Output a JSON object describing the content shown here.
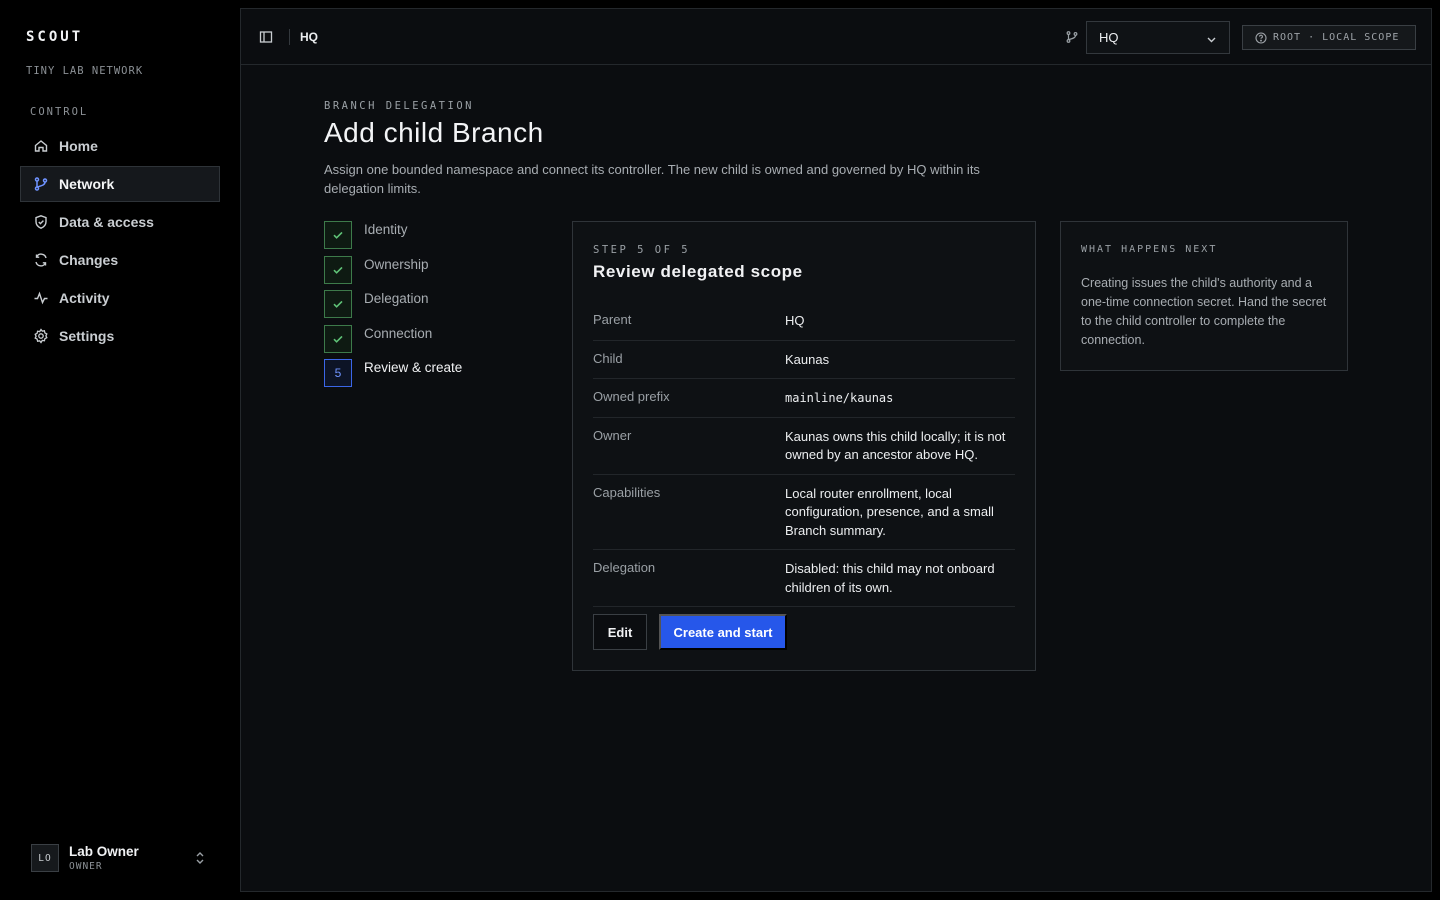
{
  "sidebar": {
    "brand": "SCOUT",
    "org": "TINY LAB NETWORK",
    "section": "CONTROL",
    "items": [
      {
        "label": "Home",
        "icon": "home-icon"
      },
      {
        "label": "Network",
        "icon": "branch-icon",
        "active": true
      },
      {
        "label": "Data & access",
        "icon": "shield-icon"
      },
      {
        "label": "Changes",
        "icon": "refresh-icon"
      },
      {
        "label": "Activity",
        "icon": "activity-icon"
      },
      {
        "label": "Settings",
        "icon": "gear-icon"
      }
    ],
    "user": {
      "initials": "LO",
      "name": "Lab Owner",
      "role": "OWNER"
    }
  },
  "topbar": {
    "breadcrumb": "HQ",
    "branch_select": "HQ",
    "scope_badge": "ROOT · LOCAL SCOPE"
  },
  "page": {
    "eyebrow": "BRANCH DELEGATION",
    "title": "Add child Branch",
    "description": "Assign one bounded namespace and connect its controller. The new child is owned and governed by HQ within its delegation limits."
  },
  "steps": [
    {
      "label": "Identity",
      "status": "done"
    },
    {
      "label": "Ownership",
      "status": "done"
    },
    {
      "label": "Delegation",
      "status": "done"
    },
    {
      "label": "Connection",
      "status": "done"
    },
    {
      "label": "Review & create",
      "status": "current",
      "number": "5"
    }
  ],
  "review": {
    "step_label": "STEP 5 OF 5",
    "title": "Review delegated scope",
    "rows": [
      {
        "key": "Parent",
        "value": "HQ"
      },
      {
        "key": "Child",
        "value": "Kaunas"
      },
      {
        "key": "Owned prefix",
        "value": "mainline/kaunas"
      },
      {
        "key": "Owner",
        "value": "Kaunas owns this child locally; it is not owned by an ancestor above HQ."
      },
      {
        "key": "Capabilities",
        "value": "Local router enrollment, local configuration, presence, and a small Branch summary."
      },
      {
        "key": "Delegation",
        "value": "Disabled: this child may not onboard children of its own."
      }
    ],
    "edit_label": "Edit",
    "create_label": "Create and start"
  },
  "info": {
    "title": "WHAT HAPPENS NEXT",
    "text": "Creating issues the child's authority and a one-time connection secret. Hand the secret to the child controller to complete the connection."
  },
  "colors": {
    "accent": "#2657ea",
    "done": "#3d7a4a",
    "current": "#3b66e8"
  }
}
